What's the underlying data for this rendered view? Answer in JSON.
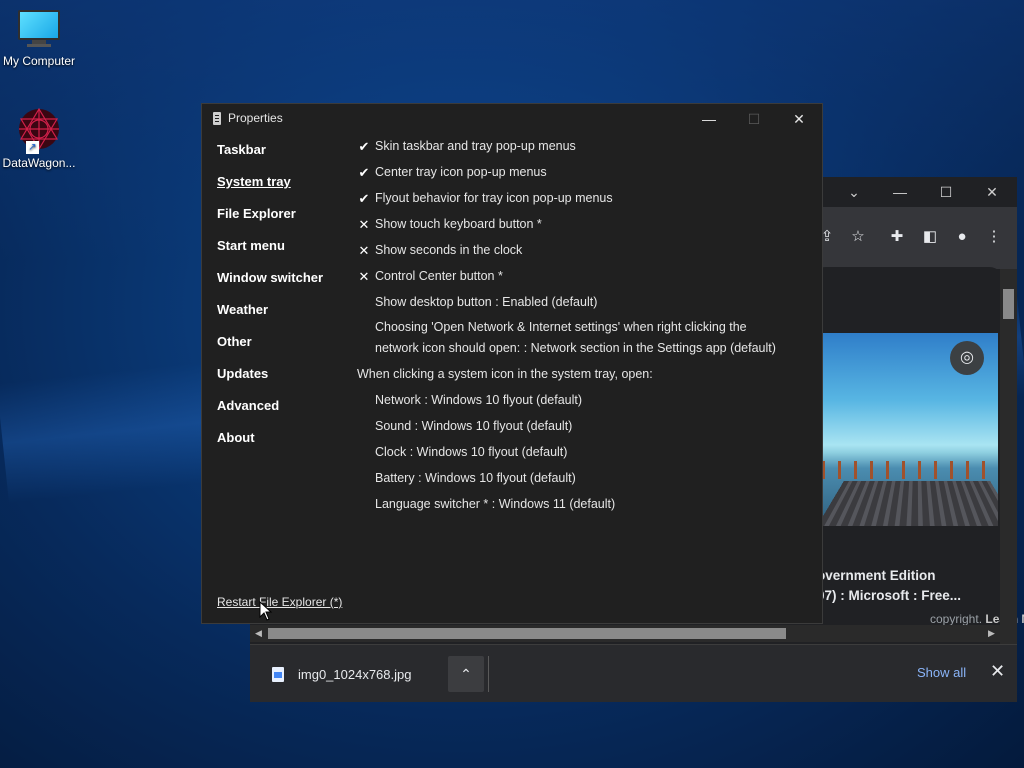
{
  "desktop": {
    "icons": [
      {
        "label": "My Computer"
      },
      {
        "label": "DataWagon..."
      }
    ]
  },
  "browser": {
    "window_controls": {
      "chevron": "⌄",
      "minimize": "—",
      "maximize": "☐",
      "close": "✕"
    },
    "toolbar_icons": [
      "share-icon",
      "star-icon",
      "extensions-icon",
      "side-panel-icon",
      "profile-icon",
      "menu-icon"
    ],
    "result": {
      "title_line1": "overnment Edition",
      "title_line2": "07) : Microsoft : Free...",
      "sub_text": "copyright.",
      "learn_more": "Learn More"
    }
  },
  "download_bar": {
    "file_name": "img0_1024x768.jpg",
    "show_all": "Show all",
    "close": "✕"
  },
  "properties": {
    "title": "Properties",
    "controls": {
      "minimize": "—",
      "maximize": "☐",
      "close": "✕"
    },
    "nav": [
      {
        "label": "Taskbar",
        "active": false
      },
      {
        "label": "System tray",
        "active": true
      },
      {
        "label": "File Explorer",
        "active": false
      },
      {
        "label": "Start menu",
        "active": false
      },
      {
        "label": "Window switcher",
        "active": false
      },
      {
        "label": "Weather",
        "active": false
      },
      {
        "label": "Other",
        "active": false
      },
      {
        "label": "Updates",
        "active": false
      },
      {
        "label": "Advanced",
        "active": false
      },
      {
        "label": "About",
        "active": false
      }
    ],
    "settings": [
      {
        "mark": "✔",
        "label": "Skin taskbar and tray pop-up menus"
      },
      {
        "mark": "✔",
        "label": "Center tray icon pop-up menus"
      },
      {
        "mark": "✔",
        "label": "Flyout behavior for tray icon pop-up menus"
      },
      {
        "mark": "✕",
        "label": "Show touch keyboard button *"
      },
      {
        "mark": "✕",
        "label": "Show seconds in the clock"
      },
      {
        "mark": "✕",
        "label": "Control Center button *"
      },
      {
        "mark": "",
        "label": "Show desktop button : Enabled (default)"
      },
      {
        "mark": "",
        "label_line1": "Choosing 'Open Network & Internet settings' when right clicking the",
        "label_line2": "network icon should open: : Network section in the Settings app (default)"
      }
    ],
    "section_heading": "When clicking a system icon in the system tray, open:",
    "flyouts": [
      {
        "label": "Network : Windows 10 flyout (default)"
      },
      {
        "label": "Sound : Windows 10 flyout (default)"
      },
      {
        "label": "Clock : Windows 10 flyout (default)"
      },
      {
        "label": "Battery : Windows 10 flyout (default)"
      },
      {
        "label": "Language switcher * : Windows 11 (default)"
      }
    ],
    "restart_link": "Restart File Explorer (*)"
  }
}
